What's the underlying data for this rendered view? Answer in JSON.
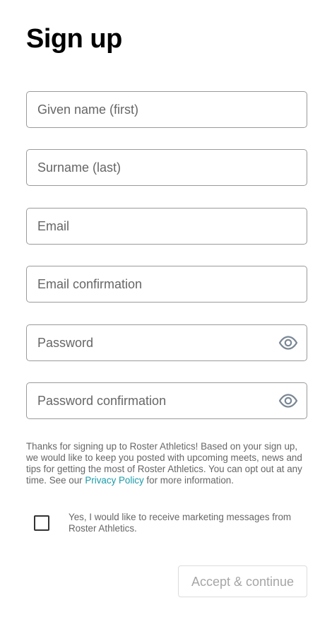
{
  "title": "Sign up",
  "fields": {
    "given_name": {
      "value": "",
      "placeholder": "Given name (first)"
    },
    "surname": {
      "value": "",
      "placeholder": "Surname (last)"
    },
    "email": {
      "value": "",
      "placeholder": "Email"
    },
    "email_confirmation": {
      "value": "",
      "placeholder": "Email confirmation"
    },
    "password": {
      "value": "",
      "placeholder": "Password",
      "toggle_icon": "eye-icon"
    },
    "password_confirmation": {
      "value": "",
      "placeholder": "Password confirmation",
      "toggle_icon": "eye-icon"
    }
  },
  "notice": {
    "text_before_link": "Thanks for signing up to Roster Athletics! Based on your sign up, we would like to keep you posted with upcoming meets, news and tips for getting the most of Roster Athletics. You can opt out at any time. See our ",
    "link_text": "Privacy Policy",
    "text_after_link": " for more information."
  },
  "marketing_consent": {
    "checked": false,
    "label": "Yes, I would like to receive marketing messages from Roster Athletics."
  },
  "submit": {
    "label": "Accept & continue",
    "enabled": false
  },
  "colors": {
    "link": "#1a9aa8",
    "field_border": "#9a9a9a",
    "muted_text": "#666666",
    "disabled_button_text": "#a6a6a6",
    "eye_icon": "#7a8794"
  }
}
